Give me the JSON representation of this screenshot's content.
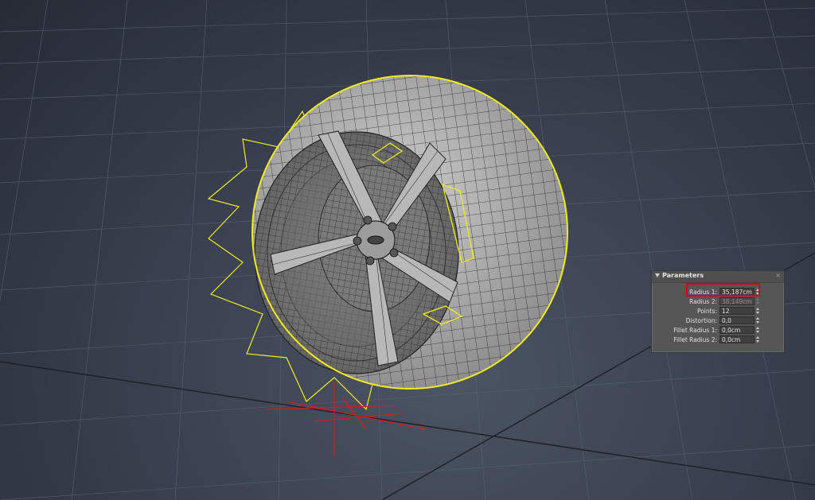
{
  "colors": {
    "selection": "#f1ea1e",
    "gizmo": "#e01818",
    "highlight": "#e00000",
    "panel_bg": "#565656",
    "mesh_fill": "#a8a8a8",
    "wire": "#2a2a2a"
  },
  "panel": {
    "title": "Parameters",
    "rows": [
      {
        "label": "Radius 1:",
        "value": "35,187cm",
        "enabled": true
      },
      {
        "label": "Radius 2:",
        "value": "38,149cm",
        "enabled": false
      },
      {
        "label": "Points:",
        "value": "12",
        "enabled": true
      },
      {
        "label": "Distortion:",
        "value": "0,0",
        "enabled": true
      },
      {
        "label": "Fillet Radius 1:",
        "value": "0,0cm",
        "enabled": true
      },
      {
        "label": "Fillet Radius 2:",
        "value": "0,0cm",
        "enabled": true
      }
    ],
    "highlighted_row": "Radius 1:"
  },
  "icons": [
    "collapse-arrow-icon",
    "close-icon",
    "spinner-icon",
    "transform-gizmo-icon"
  ]
}
